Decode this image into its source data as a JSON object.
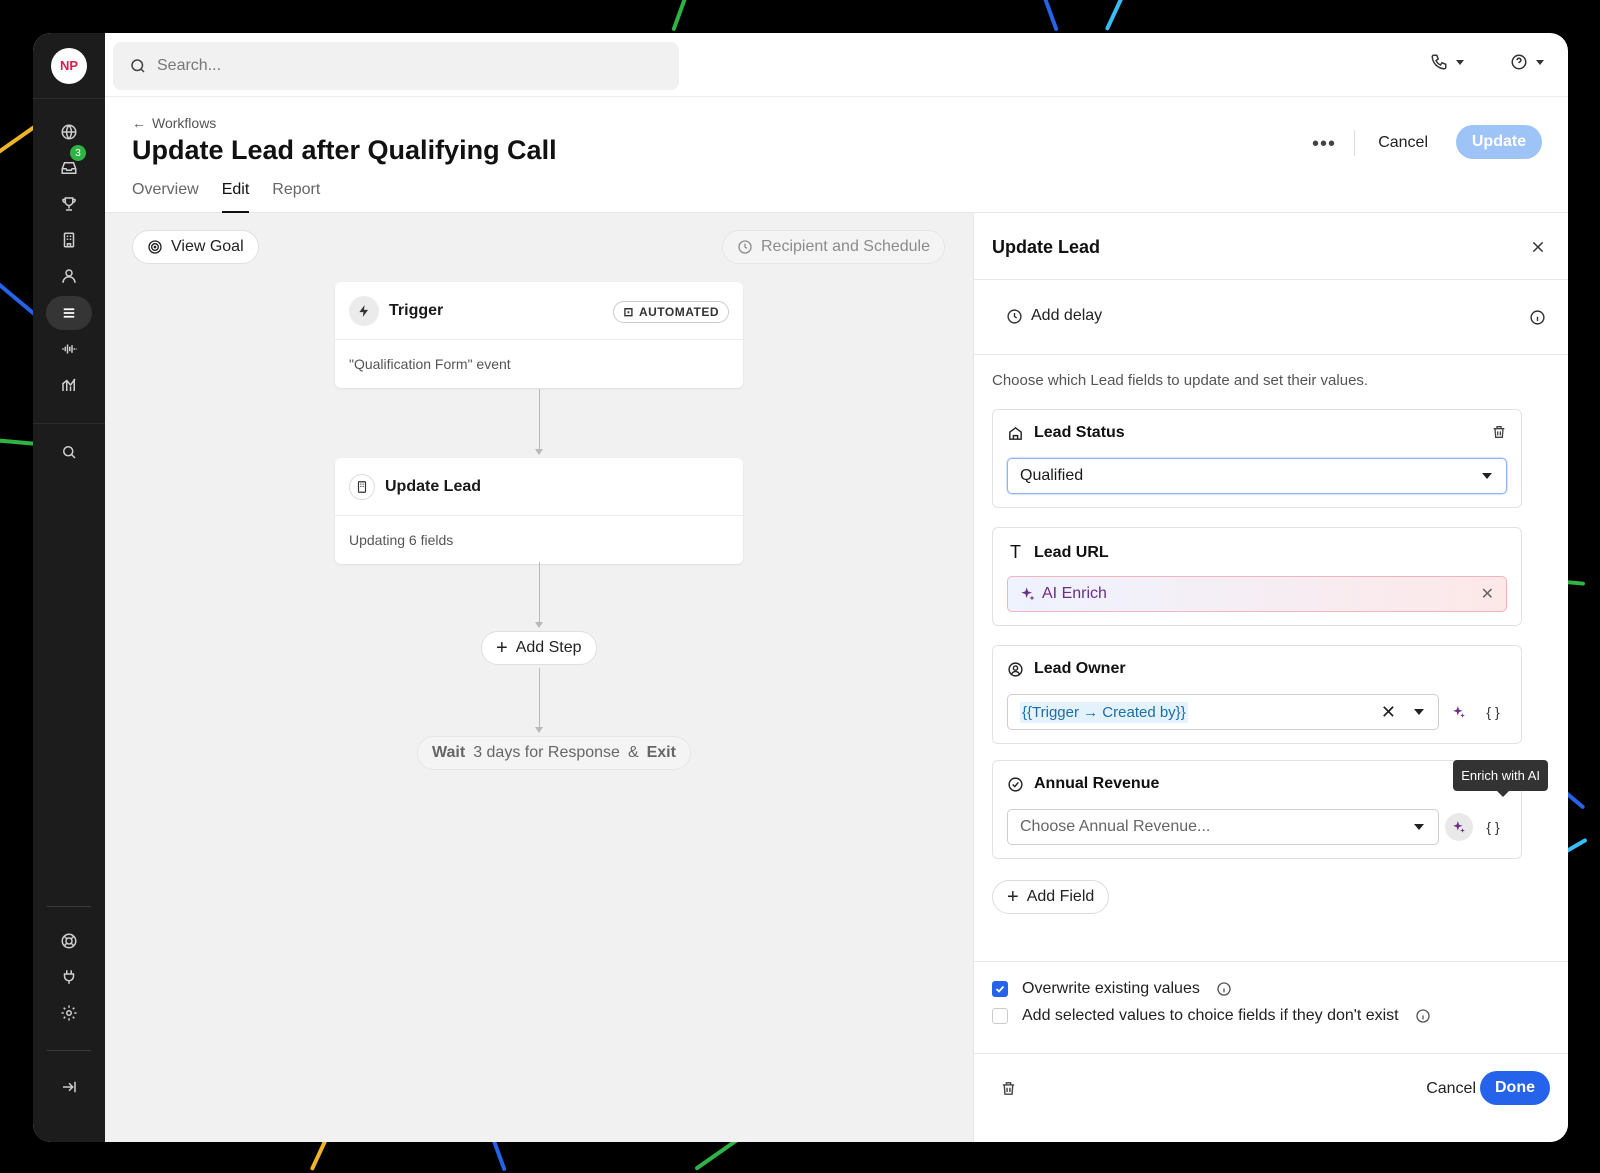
{
  "user": {
    "initials": "NP"
  },
  "rail": {
    "inbox_badge": "3"
  },
  "search": {
    "placeholder": "Search..."
  },
  "header": {
    "breadcrumb": "Workflows",
    "title": "Update Lead after Qualifying Call",
    "tabs": [
      {
        "label": "Overview"
      },
      {
        "label": "Edit"
      },
      {
        "label": "Report"
      }
    ],
    "more": "•••",
    "cancel_label": "Cancel",
    "update_label": "Update"
  },
  "canvas": {
    "view_goal": "View Goal",
    "recipient_schedule": "Recipient and Schedule",
    "trigger": {
      "title": "Trigger",
      "badge": "AUTOMATED",
      "body": "\"Qualification Form\" event"
    },
    "update_lead": {
      "title": "Update Lead",
      "body": "Updating 6 fields"
    },
    "add_step": "Add Step",
    "exit": {
      "wait": "Wait",
      "duration": "3 days for Response",
      "amp": "&",
      "exit": "Exit"
    }
  },
  "panel": {
    "title": "Update Lead",
    "add_delay": "Add delay",
    "hint": "Choose which Lead fields to update and set their values.",
    "fields": [
      {
        "label": "Lead Status",
        "value": "Qualified"
      },
      {
        "label": "Lead URL",
        "value": "AI Enrich"
      },
      {
        "label": "Lead Owner",
        "value": "{{Trigger → Created by}}"
      },
      {
        "label": "Annual Revenue",
        "placeholder": "Choose Annual Revenue..."
      }
    ],
    "tooltip": "Enrich with AI",
    "add_field": "Add Field",
    "overwrite": {
      "label": "Overwrite existing values",
      "checked": true
    },
    "add_choices": {
      "label": "Add selected values to choice fields if they don't exist",
      "checked": false
    },
    "cancel_label": "Cancel",
    "done_label": "Done"
  },
  "colors": {
    "accent": "#2563eb",
    "update_disabled": "#9dc3f7",
    "badge": "#2fb344"
  }
}
